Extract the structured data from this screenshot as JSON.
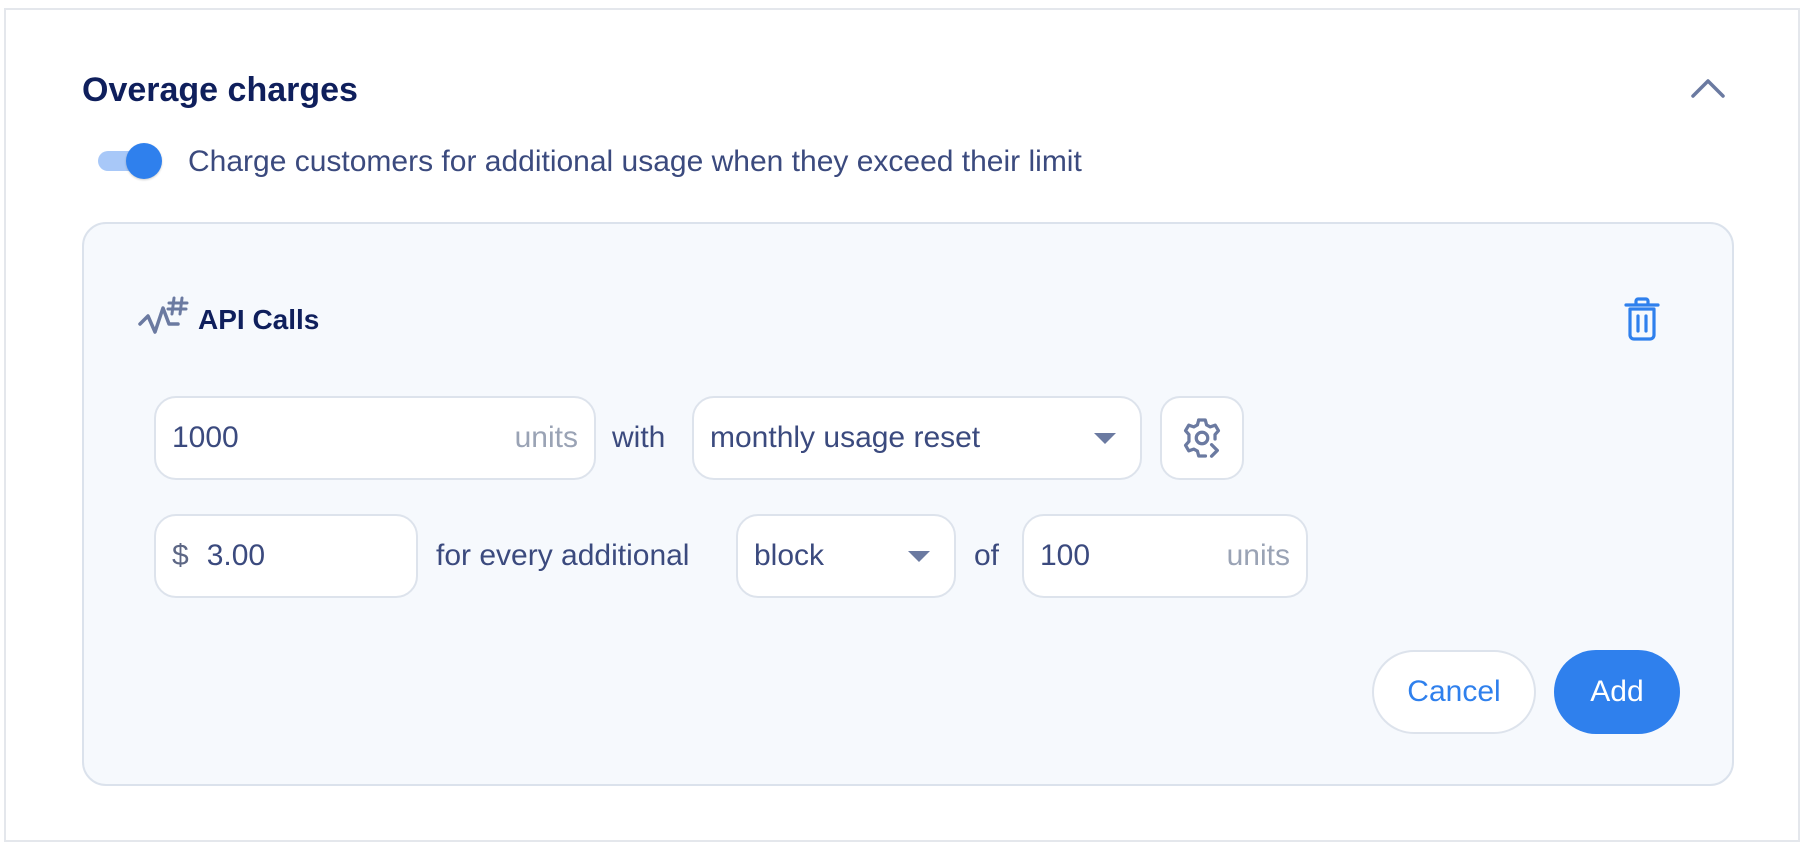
{
  "section": {
    "title": "Overage charges",
    "collapse_icon": "chevron-up-icon"
  },
  "overage_toggle": {
    "enabled": true,
    "label": "Charge customers for additional usage when they exceed their limit"
  },
  "metric": {
    "name": "API Calls",
    "icon": "metric-activity-hash-icon",
    "delete_icon": "trash-icon"
  },
  "limit_row": {
    "quantity": "1000",
    "quantity_unit": "units",
    "connector": "with",
    "reset": {
      "selected": "monthly usage reset"
    },
    "settings_icon": "gear-icon"
  },
  "price_row": {
    "currency_symbol": "$",
    "price": "3.00",
    "connector": "for every additional",
    "billing_model": {
      "selected": "block"
    },
    "of_label": "of",
    "block_size": "100",
    "block_unit": "units"
  },
  "actions": {
    "cancel_label": "Cancel",
    "add_label": "Add"
  },
  "colors": {
    "primary": "#2f80ed",
    "heading": "#0f1f5c",
    "text": "#3b4a7e",
    "panel_background": "#f6f9fd"
  }
}
